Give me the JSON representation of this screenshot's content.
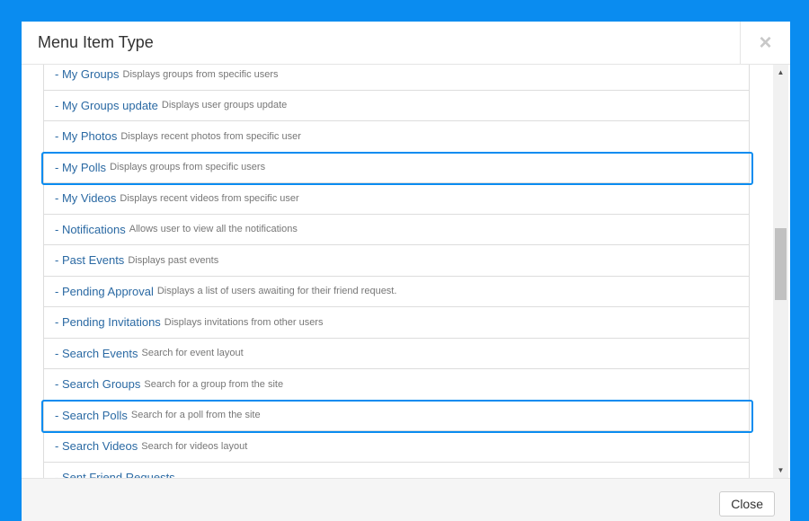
{
  "modal": {
    "title": "Menu Item Type",
    "close_x": "×",
    "footer": {
      "close_label": "Close"
    }
  },
  "items": [
    {
      "title": "- My Groups",
      "desc": "Displays groups from specific users"
    },
    {
      "title": "- My Groups update",
      "desc": "Displays user groups update"
    },
    {
      "title": "- My Photos",
      "desc": "Displays recent photos from specific user"
    },
    {
      "title": "- My Polls",
      "desc": "Displays groups from specific users",
      "highlighted": true
    },
    {
      "title": "- My Videos",
      "desc": "Displays recent videos from specific user"
    },
    {
      "title": "- Notifications",
      "desc": "Allows user to view all the notifications"
    },
    {
      "title": "- Past Events",
      "desc": "Displays past events"
    },
    {
      "title": "- Pending Approval",
      "desc": "Displays a list of users awaiting for their friend request."
    },
    {
      "title": "- Pending Invitations",
      "desc": "Displays invitations from other users"
    },
    {
      "title": "- Search Events",
      "desc": "Search for event layout"
    },
    {
      "title": "- Search Groups",
      "desc": "Search for a group from the site"
    },
    {
      "title": "- Search Polls",
      "desc": "Search for a poll from the site",
      "highlighted": true
    },
    {
      "title": "- Search Videos",
      "desc": "Search for videos layout"
    },
    {
      "title": "- Sent Friend Requests",
      "desc": ""
    }
  ],
  "scrollbar": {
    "up_glyph": "▲",
    "down_glyph": "▼"
  },
  "colors": {
    "background": "#0a8cf0",
    "highlight": "#0a8cf0",
    "link": "#2a69a3",
    "desc": "#777777"
  }
}
